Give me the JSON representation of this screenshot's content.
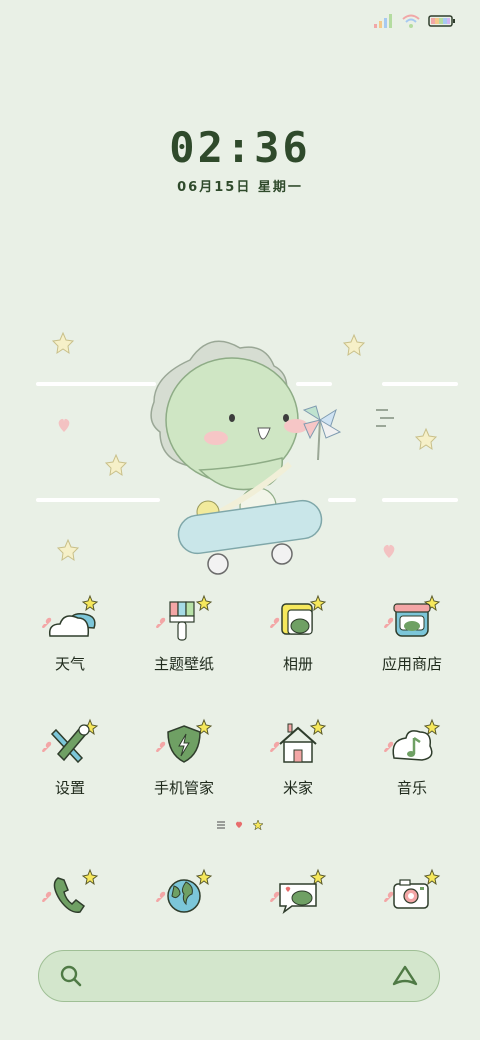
{
  "status_bar": {
    "icons": [
      "signal-icon",
      "wifi-icon",
      "battery-icon"
    ]
  },
  "clock": {
    "time": "02:36",
    "date": "06月15日 星期一"
  },
  "apps_row1": [
    {
      "label": "天气",
      "icon": "weather-cloud-icon"
    },
    {
      "label": "主题壁纸",
      "icon": "paintbrush-icon"
    },
    {
      "label": "相册",
      "icon": "gallery-icon"
    },
    {
      "label": "应用商店",
      "icon": "app-store-icon"
    }
  ],
  "apps_row2": [
    {
      "label": "设置",
      "icon": "wrench-icon"
    },
    {
      "label": "手机管家",
      "icon": "shield-icon"
    },
    {
      "label": "米家",
      "icon": "house-icon"
    },
    {
      "label": "音乐",
      "icon": "music-note-icon"
    }
  ],
  "dock": [
    {
      "icon": "phone-icon"
    },
    {
      "icon": "globe-icon"
    },
    {
      "icon": "chat-bubble-icon"
    },
    {
      "icon": "camera-icon"
    }
  ],
  "search": {
    "placeholder": ""
  },
  "colors": {
    "background": "#e9f0e6",
    "accent_green": "#4f7a45",
    "search_bg": "#d3e6cc"
  }
}
